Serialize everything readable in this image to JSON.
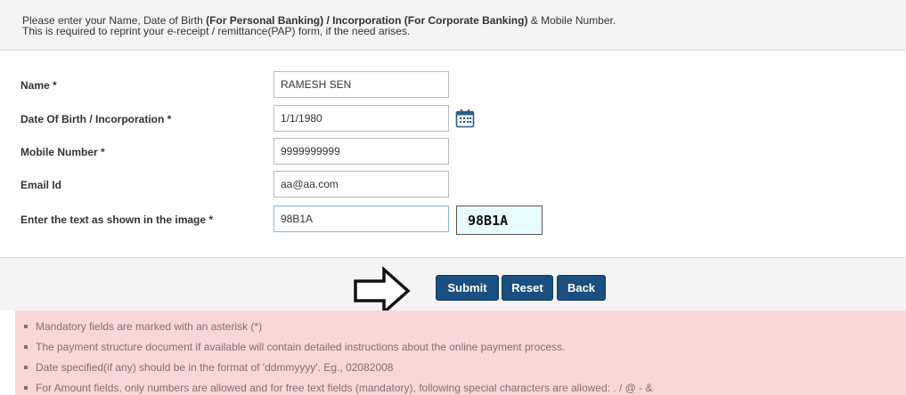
{
  "header": {
    "line1_prefix": "Please enter your Name, Date of Birth ",
    "line1_bold1": "(For Personal Banking) / Incorporation (For Corporate Banking)",
    "line1_suffix": " & Mobile Number.",
    "line2": "This is required to reprint your e-receipt / remittance(PAP) form, if the need arises."
  },
  "form": {
    "name": {
      "label": "Name *",
      "value": "RAMESH SEN"
    },
    "dob": {
      "label": "Date Of Birth / Incorporation *",
      "value": "1/1/1980"
    },
    "mobile": {
      "label": "Mobile Number *",
      "value": "9999999999"
    },
    "email": {
      "label": "Email Id",
      "value": "aa@aa.com"
    },
    "captcha": {
      "label": "Enter the text as shown in the image *",
      "value": "98B1A",
      "image_text": "98B1A"
    }
  },
  "buttons": {
    "submit": "Submit",
    "reset": "Reset",
    "back": "Back"
  },
  "notes": [
    "Mandatory fields are marked with an asterisk (*)",
    "The payment structure document if available will contain detailed instructions about the online payment process.",
    "Date specified(if any) should be in the format of 'ddmmyyyy'. Eg., 02082008",
    "For Amount fields, only numbers are allowed and for free text fields (mandatory), following special characters are allowed: . / @ -   &"
  ],
  "colors": {
    "button_bg": "#1a4f80",
    "notes_bg": "#f8d7d8",
    "captcha_bg": "#e8fbff"
  },
  "icons": {
    "calendar": "calendar-icon",
    "arrow": "right-arrow-icon"
  }
}
